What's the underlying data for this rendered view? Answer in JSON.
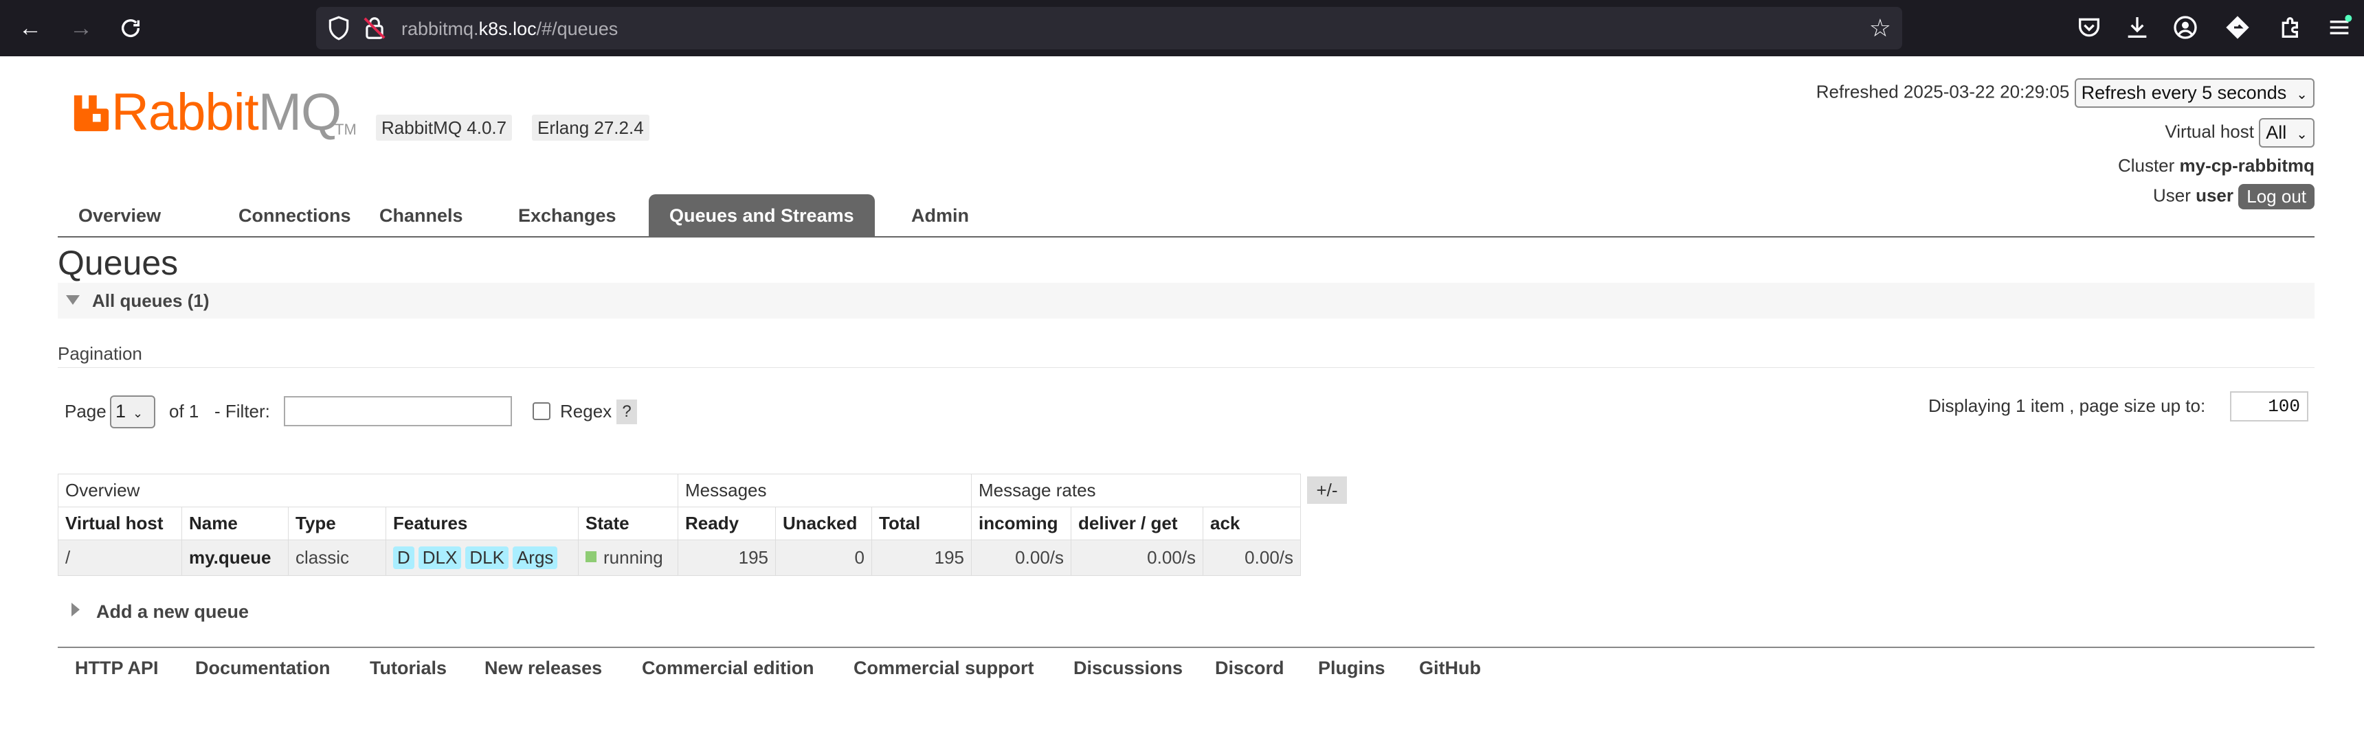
{
  "browser": {
    "url_prefix": "rabbitmq.",
    "url_host": "k8s.loc",
    "url_path": "/#/queues"
  },
  "header": {
    "brand_rabbit": "Rabbit",
    "brand_mq": "MQ",
    "brand_tm": "TM",
    "version": "RabbitMQ 4.0.7",
    "erlang": "Erlang 27.2.4",
    "refreshed_label": "Refreshed 2025-03-22 20:29:05",
    "refresh_select": "Refresh every 5 seconds",
    "vhost_label": "Virtual host",
    "vhost_select": "All",
    "cluster_label": "Cluster",
    "cluster_name": "my-cp-rabbitmq",
    "user_label": "User",
    "user_name": "user",
    "logout": "Log out"
  },
  "tabs": [
    "Overview",
    "Connections",
    "Channels",
    "Exchanges",
    "Queues and Streams",
    "Admin"
  ],
  "active_tab": "Queues and Streams",
  "page": {
    "title": "Queues",
    "section": "All queues (1)",
    "pagination_title": "Pagination",
    "page_label": "Page",
    "page_value": "1",
    "of_label": "of 1",
    "filter_label": "- Filter:",
    "regex_label": "Regex",
    "help": "?",
    "displaying": "Displaying 1 item , page size up to:",
    "page_size": "100"
  },
  "table": {
    "groups": [
      "Overview",
      "Messages",
      "Message rates"
    ],
    "toggle": "+/-",
    "columns": [
      "Virtual host",
      "Name",
      "Type",
      "Features",
      "State",
      "Ready",
      "Unacked",
      "Total",
      "incoming",
      "deliver / get",
      "ack"
    ],
    "rows": [
      {
        "vhost": "/",
        "name": "my.queue",
        "type": "classic",
        "features": [
          "D",
          "DLX",
          "DLK",
          "Args"
        ],
        "state": "running",
        "ready": "195",
        "unacked": "0",
        "total": "195",
        "incoming": "0.00/s",
        "deliver_get": "0.00/s",
        "ack": "0.00/s"
      }
    ]
  },
  "add_queue": "Add a new queue",
  "footer": [
    "HTTP API",
    "Documentation",
    "Tutorials",
    "New releases",
    "Commercial edition",
    "Commercial support",
    "Discussions",
    "Discord",
    "Plugins",
    "GitHub"
  ],
  "colors": {
    "brand": "#ff6600",
    "active_tab": "#666666",
    "feature_badge": "#aaeeff",
    "running": "#8ecc74"
  }
}
